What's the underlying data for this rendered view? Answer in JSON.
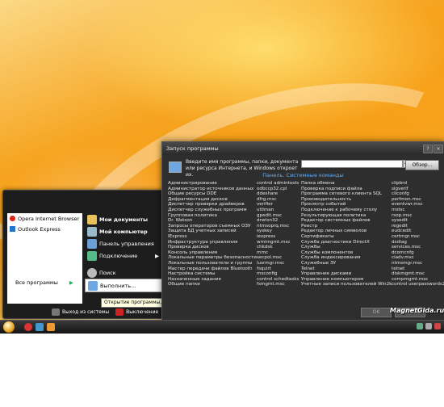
{
  "start_menu": {
    "pinned": [
      {
        "label": "Opera Internet Browser",
        "color": "#d21"
      },
      {
        "label": "Outlook Express",
        "color": "#27c"
      }
    ],
    "all_programs": "Все программы",
    "right_items": [
      {
        "label": "Мои документы",
        "bold": true
      },
      {
        "label": "Мой компьютер",
        "bold": true
      },
      {
        "label": "Панель управления",
        "bold": false
      },
      {
        "label": "Подключение",
        "bold": false
      },
      {
        "label": "Поиск",
        "bold": false
      },
      {
        "label": "Выполнить...",
        "bold": false
      }
    ],
    "logoff": "Выход из системы",
    "shutdown": "Выключение",
    "tooltip": "Открытие программы, папки, документа или веб-узла."
  },
  "run_dialog": {
    "title": "Запуск программы",
    "description": "Введите имя программы, папки, документа или ресурса Интернета, и Windows откроет их.",
    "input_value": "",
    "browse": "Обзор...",
    "panel_title": "Панель. Системные команды",
    "columns": [
      [
        "Администрирование",
        "Администратор источников данных",
        "Общие ресурсы DDE",
        "Дефрагментация дисков",
        "Диспетчер проверки драйверов",
        "Диспетчер служебных программ",
        "Групповая политика",
        "Dr. Watson",
        "Запросы операторов съемных ОЗУ",
        "Защита БД учетных записей",
        "IExpress",
        "Инфраструктура управления",
        "Проверка дисков",
        "Консоль управления",
        "Локальные параметры безопасности",
        "Локальные пользователи и группы",
        "Мастер передачи файлов Bluetooth",
        "Настройка системы",
        "Назначенные задания",
        "Общие папки"
      ],
      [
        "control admintools",
        "odbccp32.cpl",
        "ddeshare",
        "dfrg.msc",
        "verifier",
        "utilman",
        "gpedit.msc",
        "drwtsn32",
        "ntmsoprq.msc",
        "syskey",
        "iexpress",
        "wmimgmt.msc",
        "chkdsk",
        "mmc",
        "secpol.msc",
        "lusrmgr.msc",
        "fsquirt",
        "msconfig",
        "control schedtasks",
        "fsmgmt.msc"
      ],
      [
        "Папка обмена",
        "Проверка подписи файла",
        "Программа сетевого клиента SQL",
        "Производительность",
        "Просмотр событий",
        "Подключение к рабочему столу",
        "Результирующая политика",
        "Редактор системных файлов",
        "Реестр",
        "Редактор личных символов",
        "Сертификаты",
        "Служба диагностики DirectX",
        "Службы",
        "Службы компонентов",
        "Служба индексирования",
        "Служебные ЗУ",
        "Telnet",
        "Управление дисками",
        "Управление компьютером",
        "Учетные записи пользователей Win2k"
      ],
      [
        "clipbrd",
        "sigverif",
        "cliconfg",
        "perfmon.msc",
        "eventvwr.msc",
        "mstsc",
        "rsop.msc",
        "sysedit",
        "regedit",
        "eudcedit",
        "certmgr.msc",
        "dxdiag",
        "services.msc",
        "dcomcnfg",
        "ciadv.msc",
        "ntmsmgr.msc",
        "telnet",
        "diskmgmt.msc",
        "compmgmt.msc",
        "control userpasswords2"
      ]
    ],
    "ok": "OK",
    "cancel": "Отмена"
  },
  "watermark": "MagnetGida.ru",
  "colors": {
    "accent": "#f6a521",
    "panel_link": "#5ab0ff"
  }
}
